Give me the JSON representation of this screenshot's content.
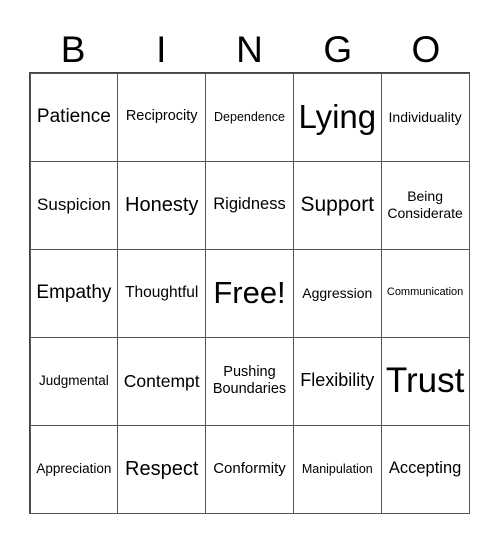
{
  "header": [
    "B",
    "I",
    "N",
    "G",
    "O"
  ],
  "cells": [
    [
      "Patience",
      "Reciprocity",
      "Dependence",
      "Lying",
      "Individuality"
    ],
    [
      "Suspicion",
      "Honesty",
      "Rigidness",
      "Support",
      "Being Considerate"
    ],
    [
      "Empathy",
      "Thoughtful",
      "Free!",
      "Aggression",
      "Communication"
    ],
    [
      "Judgmental",
      "Contempt",
      "Pushing Boundaries",
      "Flexibility",
      "Trust"
    ],
    [
      "Appreciation",
      "Respect",
      "Conformity",
      "Manipulation",
      "Accepting"
    ]
  ]
}
